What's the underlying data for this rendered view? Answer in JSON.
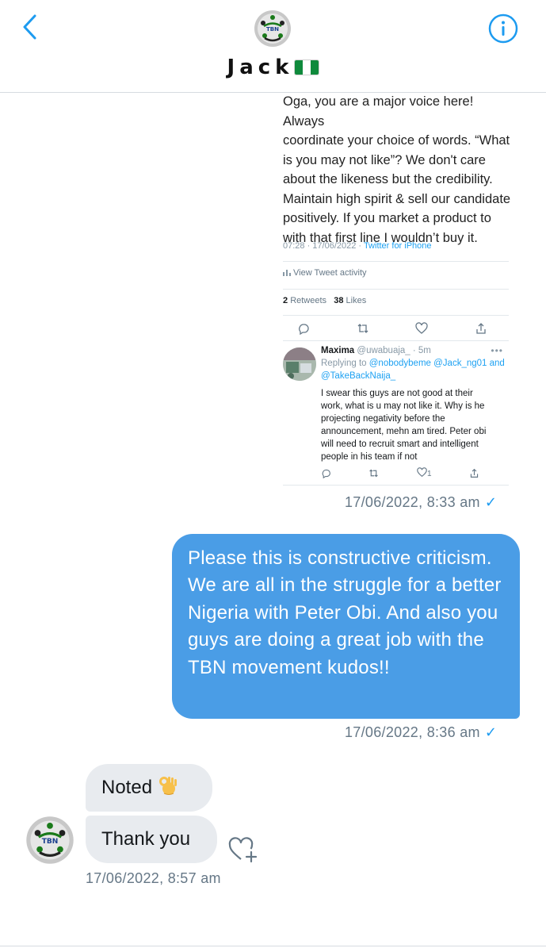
{
  "header": {
    "contact_name": "Jack",
    "back_icon": "chevron-left-icon",
    "info_icon": "info-circle-icon",
    "avatar_text": "TBN",
    "accent_color": "#1d9bf0"
  },
  "messages": {
    "tweet": {
      "lines": [
        "Oga, you are a major voice here! Always",
        "coordinate your choice of words. “What",
        "is you may not like”? We don't care",
        "about the likeness but the credibility.",
        "Maintain high spirit & sell our candidate",
        "positively. If you market a product to",
        "with that first line I wouldn’t buy it."
      ],
      "time": "07:28 · 17/06/2022 ·",
      "source": "Twitter for iPhone",
      "activity": "View Tweet activity",
      "retweets_count": "2",
      "retweets_label": "Retweets",
      "likes_count": "38",
      "likes_label": "Likes",
      "reply": {
        "name": "Maxima",
        "handle": "@uwabuaja_ · 5m",
        "replying_prefix": "Replying to",
        "mention1": "@nobodybeme",
        "mention2": "@Jack_ng01",
        "and": "and",
        "mention3": "@TakeBackNaija_",
        "text": "I swear this guys are not good at their work, what is u may not like it. Why is he projecting negativity before the announcement, mehn am tired. Peter obi will need to recruit smart and intelligent people in his team if not",
        "like_count": "1",
        "dots": "•••"
      },
      "timestamp": "17/06/2022, 8:33 am",
      "check": "✓"
    },
    "outgoing": {
      "text": "Please this is constructive criticism. We are all in the struggle for a better Nigeria with Peter Obi. And also you guys are doing a great job with the TBN movement kudos!!",
      "timestamp": "17/06/2022, 8:36 am",
      "check": "✓",
      "bubble_color": "#4a9de6"
    },
    "incoming": [
      {
        "text": "Noted",
        "emoji": "ok-hand-icon"
      },
      {
        "text": "Thank you"
      }
    ],
    "incoming_timestamp": "17/06/2022, 8:57 am",
    "incoming_bubble_color": "#e8ebef"
  }
}
